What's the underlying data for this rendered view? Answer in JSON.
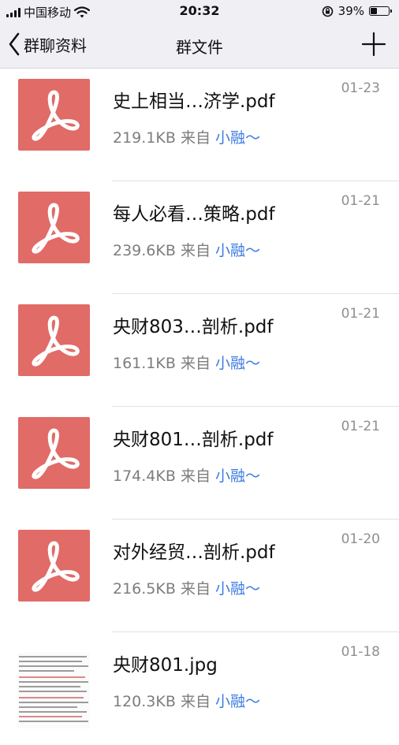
{
  "status_bar": {
    "carrier": "中国移动",
    "time": "20:32",
    "battery": "39%",
    "battery_level": 0.39
  },
  "nav": {
    "back_label": "群聊资料",
    "title": "群文件"
  },
  "files": [
    {
      "name": "史上相当…济学.pdf",
      "size": "219.1KB",
      "from_label": "来自",
      "sender": "小融～",
      "date": "01-23",
      "type": "pdf"
    },
    {
      "name": "每人必看…策略.pdf",
      "size": "239.6KB",
      "from_label": "来自",
      "sender": "小融～",
      "date": "01-21",
      "type": "pdf"
    },
    {
      "name": "央财803…剖析.pdf",
      "size": "161.1KB",
      "from_label": "来自",
      "sender": "小融～",
      "date": "01-21",
      "type": "pdf"
    },
    {
      "name": "央财801…剖析.pdf",
      "size": "174.4KB",
      "from_label": "来自",
      "sender": "小融～",
      "date": "01-21",
      "type": "pdf"
    },
    {
      "name": "对外经贸…剖析.pdf",
      "size": "216.5KB",
      "from_label": "来自",
      "sender": "小融～",
      "date": "01-20",
      "type": "pdf"
    },
    {
      "name": "央财801.jpg",
      "size": "120.3KB",
      "from_label": "来自",
      "sender": "小融～",
      "date": "01-18",
      "type": "image"
    }
  ],
  "colors": {
    "pdf_thumb": "#e06b67",
    "sender_link": "#3b7be0",
    "nav_background": "#efeff4"
  },
  "icons": {
    "back": "chevron-left-icon",
    "add": "plus-icon",
    "pdf": "acrobat-pdf-icon",
    "wifi": "wifi-icon",
    "lock": "rotation-lock-icon",
    "battery": "battery-icon"
  }
}
